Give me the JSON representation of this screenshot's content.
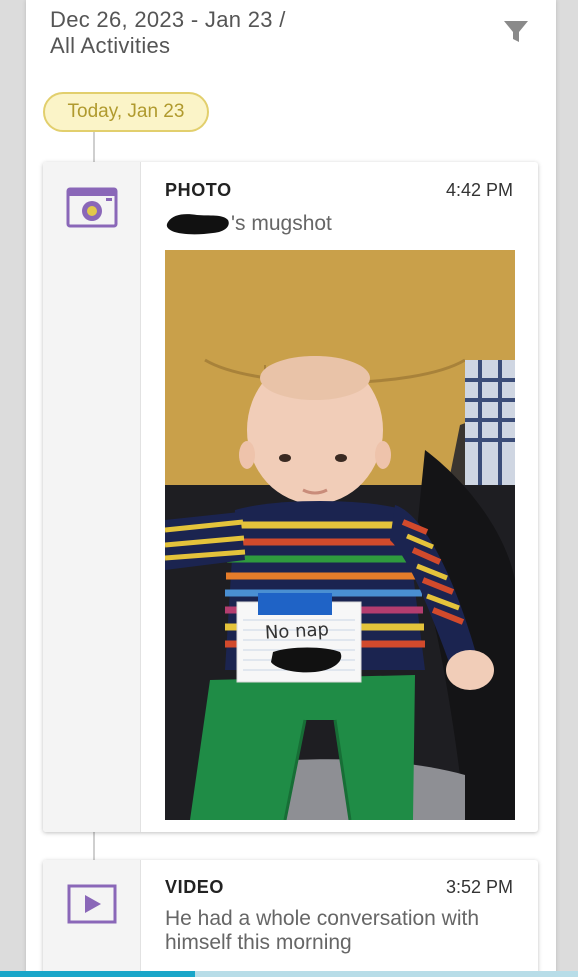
{
  "header": {
    "date_range": "Dec 26, 2023 - Jan 23 /",
    "filter_label": "All Activities"
  },
  "timeline": {
    "date_label": "Today, Jan 23"
  },
  "colors": {
    "accent_purple": "#8a67b8",
    "date_pill_bg": "#fbf4c8",
    "date_pill_border": "#e2cf6d",
    "date_pill_text": "#b09a2e",
    "progress": "#1aa6c9"
  },
  "activities": [
    {
      "type": "PHOTO",
      "time": "4:42 PM",
      "description_suffix": "'s mugshot",
      "icon": "camera-icon",
      "photo": {
        "sign_text": "No nap"
      }
    },
    {
      "type": "VIDEO",
      "time": "3:52 PM",
      "description": "He had a whole conversation with himself this morning",
      "icon": "video-play-icon"
    }
  ]
}
